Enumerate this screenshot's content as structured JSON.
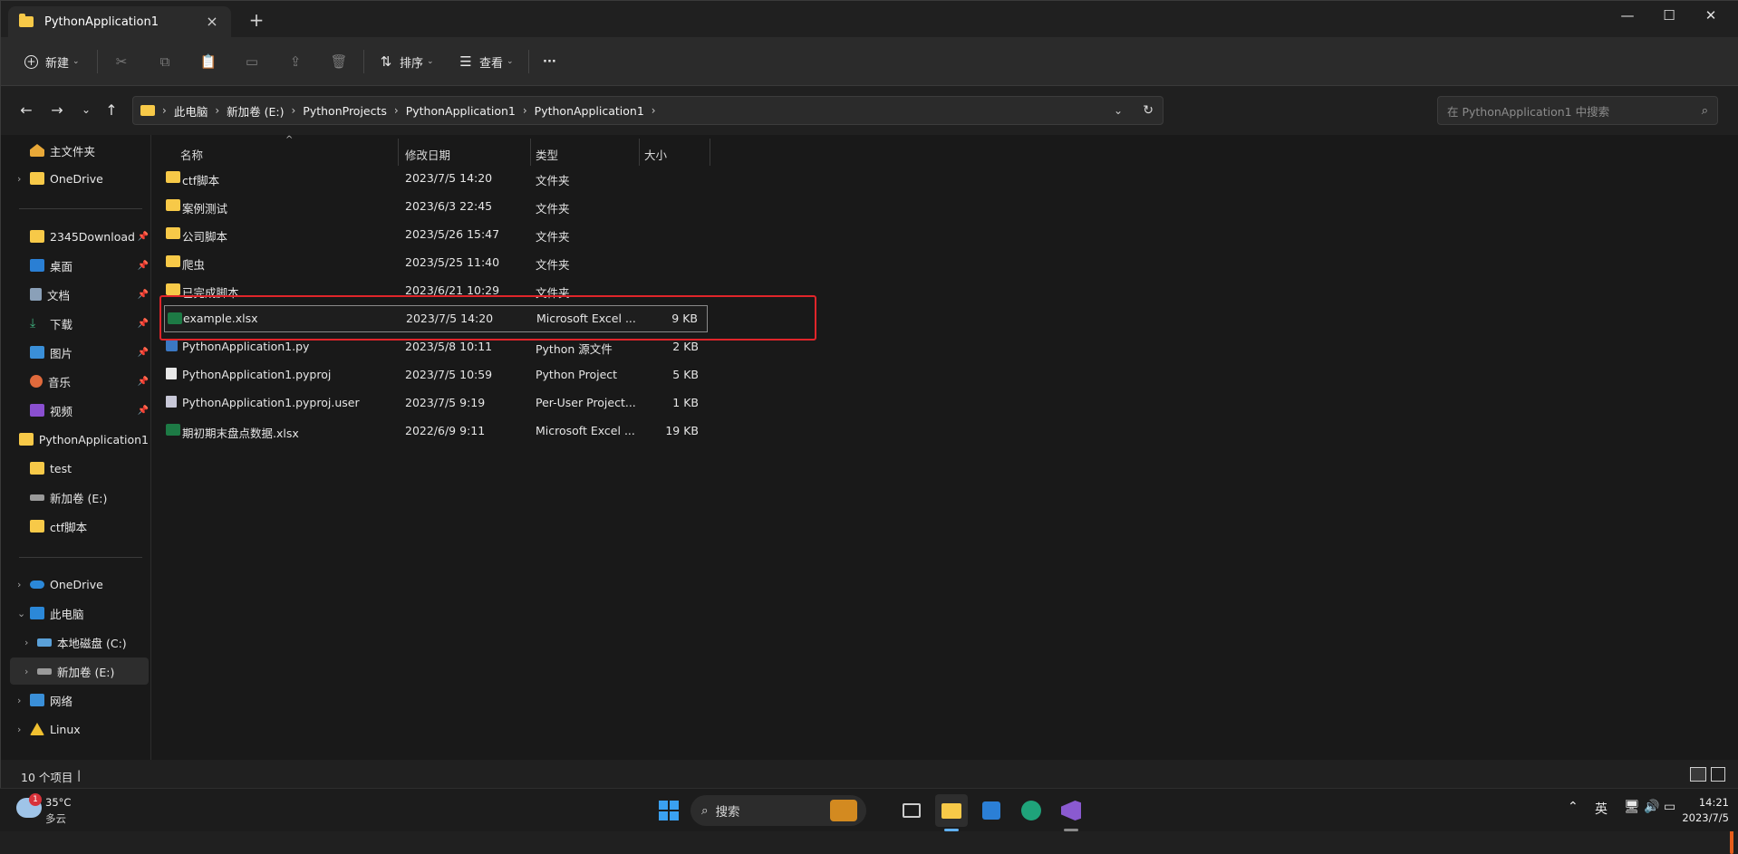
{
  "window": {
    "tab_title": "PythonApplication1",
    "tab_close": "×",
    "tab_add": "+",
    "minimize": "—",
    "maximize": "☐",
    "close": "✕"
  },
  "toolbar": {
    "new_label": "新建",
    "sort_label": "排序",
    "view_label": "查看",
    "more_label": "···"
  },
  "address": {
    "crumbs": [
      "此电脑",
      "新加卷 (E:)",
      "PythonProjects",
      "PythonApplication1",
      "PythonApplication1"
    ],
    "search_placeholder": "在 PythonApplication1 中搜索"
  },
  "sidebar": {
    "quick": [
      {
        "label": "主文件夹",
        "icon": "home-icon",
        "pinned": false,
        "chevron": false
      },
      {
        "label": "OneDrive",
        "icon": "onedrive-folder-icon",
        "pinned": false,
        "chevron": true
      }
    ],
    "pinned": [
      {
        "label": "2345Download",
        "icon": "folder-icon",
        "pinned": true
      },
      {
        "label": "桌面",
        "icon": "desktop-icon",
        "pinned": true
      },
      {
        "label": "文档",
        "icon": "document-icon",
        "pinned": true
      },
      {
        "label": "下载",
        "icon": "download-icon",
        "pinned": true
      },
      {
        "label": "图片",
        "icon": "picture-icon",
        "pinned": true
      },
      {
        "label": "音乐",
        "icon": "music-icon",
        "pinned": true
      },
      {
        "label": "视频",
        "icon": "video-icon",
        "pinned": true
      },
      {
        "label": "PythonApplication1",
        "icon": "folder-icon",
        "pinned": false
      },
      {
        "label": "test",
        "icon": "folder-icon",
        "pinned": false
      },
      {
        "label": "新加卷 (E:)",
        "icon": "drive-icon",
        "pinned": false
      },
      {
        "label": "ctf脚本",
        "icon": "folder-icon",
        "pinned": false
      }
    ],
    "tree": [
      {
        "label": "OneDrive",
        "icon": "cloud-icon",
        "chevron": "›"
      },
      {
        "label": "此电脑",
        "icon": "computer-icon",
        "chevron": "⌄"
      },
      {
        "label": "本地磁盘 (C:)",
        "icon": "system-drive-icon",
        "chevron": "›"
      },
      {
        "label": "新加卷 (E:)",
        "icon": "drive-icon",
        "chevron": "›"
      },
      {
        "label": "网络",
        "icon": "network-icon",
        "chevron": "›"
      },
      {
        "label": "Linux",
        "icon": "linux-icon",
        "chevron": "›"
      }
    ]
  },
  "columns": {
    "name": "名称",
    "date": "修改日期",
    "type": "类型",
    "size": "大小"
  },
  "files": [
    {
      "name": "ctf脚本",
      "date": "2023/7/5 14:20",
      "type": "文件夹",
      "size": "",
      "icon": "folder-icon"
    },
    {
      "name": "案例测试",
      "date": "2023/6/3 22:45",
      "type": "文件夹",
      "size": "",
      "icon": "folder-icon"
    },
    {
      "name": "公司脚本",
      "date": "2023/5/26 15:47",
      "type": "文件夹",
      "size": "",
      "icon": "folder-icon"
    },
    {
      "name": "爬虫",
      "date": "2023/5/25 11:40",
      "type": "文件夹",
      "size": "",
      "icon": "folder-icon"
    },
    {
      "name": "已完成脚本",
      "date": "2023/6/21 10:29",
      "type": "文件夹",
      "size": "",
      "icon": "folder-icon"
    },
    {
      "name": "example.xlsx",
      "date": "2023/7/5 14:20",
      "type": "Microsoft Excel ...",
      "size": "9 KB",
      "icon": "excel-file-icon"
    },
    {
      "name": "PythonApplication1.py",
      "date": "2023/5/8 10:11",
      "type": "Python 源文件",
      "size": "2 KB",
      "icon": "python-file-icon"
    },
    {
      "name": "PythonApplication1.pyproj",
      "date": "2023/7/5 10:59",
      "type": "Python Project",
      "size": "5 KB",
      "icon": "file-icon"
    },
    {
      "name": "PythonApplication1.pyproj.user",
      "date": "2023/7/5 9:19",
      "type": "Per-User Project...",
      "size": "1 KB",
      "icon": "settings-file-icon"
    },
    {
      "name": "期初期末盘点数据.xlsx",
      "date": "2022/6/9 9:11",
      "type": "Microsoft Excel ...",
      "size": "19 KB",
      "icon": "excel-file-icon"
    }
  ],
  "status": {
    "count": "10 个项目",
    "cursor": "|"
  },
  "taskbar": {
    "weather_temp": "35°C",
    "weather_desc": "多云",
    "weather_badge": "1",
    "search_label": "搜索",
    "ime": "英",
    "time": "14:21",
    "date": "2023/7/5"
  },
  "colors": {
    "accent": "#f7c948",
    "highlight_box": "#e0252a",
    "excel": "#1d7a45"
  }
}
